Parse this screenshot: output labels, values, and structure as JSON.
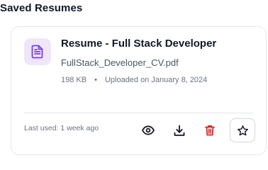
{
  "section": {
    "title": "Saved Resumes"
  },
  "resume_card": {
    "title": "Resume - Full Stack Developer",
    "file_name": "FullStack_Developer_CV.pdf",
    "file_size": "198 KB",
    "separator": "•",
    "uploaded": "Uploaded on January 8, 2024",
    "last_used": "Last used: 1 week ago",
    "file_icon": "document-icon",
    "actions": [
      {
        "name": "view",
        "icon": "eye-icon"
      },
      {
        "name": "download",
        "icon": "download-icon"
      },
      {
        "name": "delete",
        "icon": "trash-icon"
      },
      {
        "name": "favorite",
        "icon": "star-outline-icon"
      }
    ]
  },
  "colors": {
    "file_tile_bg": "#efe6fb",
    "file_icon": "#7c3aed",
    "delete_icon": "#dc2626",
    "text_primary": "#111827",
    "text_muted": "#6b7280",
    "border": "#e5e7eb"
  }
}
